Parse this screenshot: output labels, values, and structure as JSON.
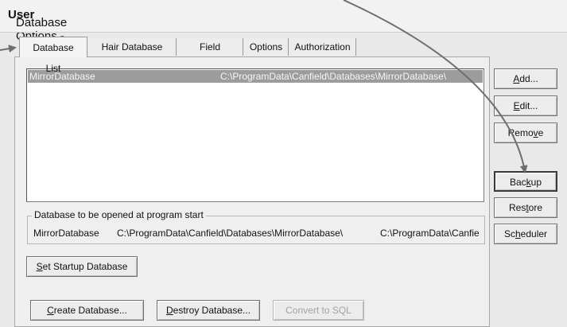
{
  "window": {
    "title_prefix": "Database Options - ",
    "title_user": "User"
  },
  "tabs": [
    {
      "label": "Database List",
      "active": true
    },
    {
      "label": "Hair Database List",
      "active": false
    },
    {
      "label": "Field Formats",
      "active": false
    },
    {
      "label": "Options",
      "active": false
    },
    {
      "label": "Authorization",
      "active": false
    }
  ],
  "database_list": {
    "rows": [
      {
        "name": "MirrorDatabase",
        "path": "C:\\ProgramData\\Canfield\\Databases\\MirrorDatabase\\",
        "selected": true
      }
    ]
  },
  "startup_group": {
    "legend": "Database to be opened at program start",
    "name": "MirrorDatabase",
    "path": "C:\\ProgramData\\Canfield\\Databases\\MirrorDatabase\\",
    "path2": "C:\\ProgramData\\Canfie"
  },
  "side_buttons": {
    "add": {
      "pre": "",
      "key": "A",
      "post": "dd..."
    },
    "edit": {
      "pre": "",
      "key": "E",
      "post": "dit..."
    },
    "remove": {
      "pre": "Remo",
      "key": "v",
      "post": "e"
    },
    "backup": {
      "pre": "Bac",
      "key": "k",
      "post": "up"
    },
    "restore": {
      "pre": "Res",
      "key": "t",
      "post": "ore"
    },
    "scheduler": {
      "pre": "Sc",
      "key": "h",
      "post": "eduler"
    }
  },
  "bottom_buttons": {
    "set_startup": {
      "pre": "",
      "key": "S",
      "post": "et Startup Database"
    },
    "create": {
      "pre": "",
      "key": "C",
      "post": "reate Database..."
    },
    "destroy": {
      "pre": "",
      "key": "D",
      "post": "estroy Database..."
    },
    "convert": {
      "label": "Convert to SQL",
      "disabled": true
    }
  },
  "colors": {
    "selection": "#9c9c9c",
    "annotation_arrow": "#6e6e6e"
  }
}
